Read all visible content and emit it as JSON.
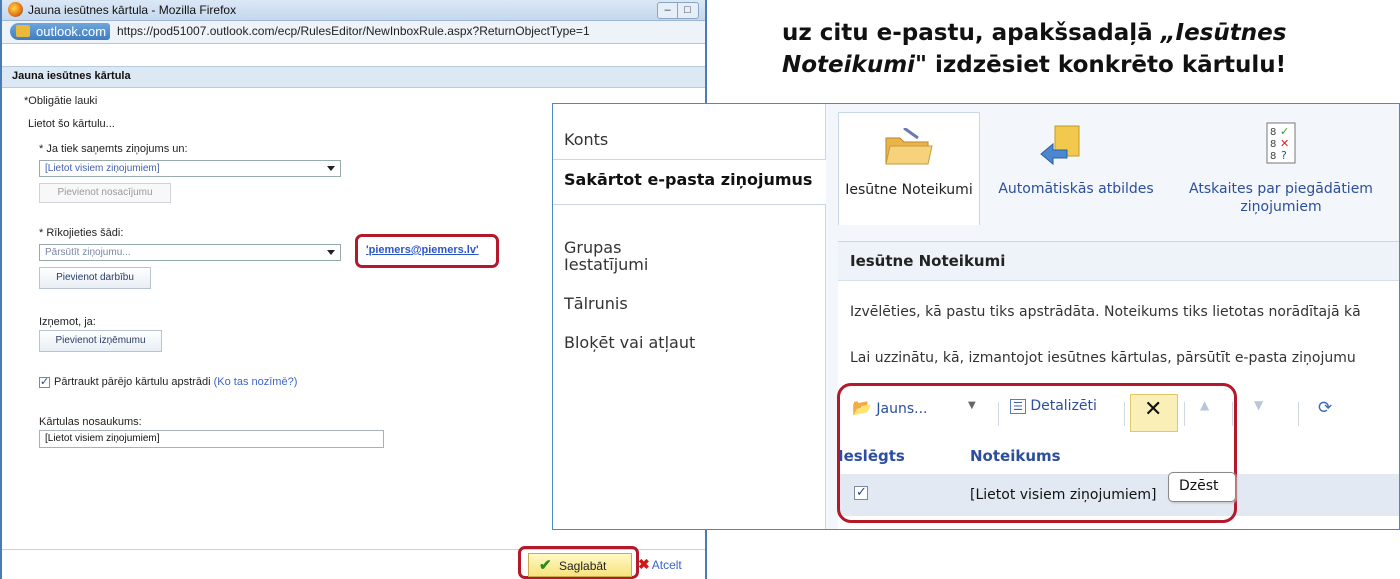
{
  "doc": {
    "line1": "uz citu e-pastu, apakšsadaļā ",
    "line1_italic": "„Iesūtnes",
    "line2_italic": "Noteikumi\"",
    "line2_rest": " izdzēsiet konkrēto kārtulu!"
  },
  "firefox": {
    "title": "Jauna iesūtnes kārtula - Mozilla Firefox",
    "site": "outlook.com",
    "url": "https://pod51007.outlook.com/ecp/RulesEditor/NewInboxRule.aspx?ReturnObjectType=1"
  },
  "rule_editor": {
    "header": "Jauna iesūtnes kārtula",
    "required_note": "*Obligātie lauki",
    "apply_label": "Lietot šo kārtulu...",
    "condition_label": "* Ja tiek saņemts ziņojums un:",
    "condition_value": "[Lietot visiem ziņojumiem]",
    "add_condition": "Pievienot nosacījumu",
    "action_label": "* Rīkojieties šādi:",
    "action_value": "Pārsūtīt ziņojumu...",
    "action_email": "'piemers@piemers.lv'",
    "add_action": "Pievienot darbību",
    "except_label": "Izņemot, ja:",
    "add_exception": "Pievienot izņēmumu",
    "stop_processing": "Pārtraukt pārējo kārtulu apstrādi",
    "what_link": "(Ko tas nozīmē?)",
    "name_label": "Kārtulas nosaukums:",
    "name_value": "[Lietot visiem ziņojumiem]",
    "save": "Saglabāt",
    "cancel": "Atcelt"
  },
  "options": {
    "nav": [
      "Konts",
      "Sakārtot e-pasta ziņojumus",
      "Grupas",
      "Iestatījumi",
      "Tālrunis",
      "Bloķēt vai atļaut"
    ],
    "tabs": {
      "inbox_rules": "Iesūtne Noteikumi",
      "auto_replies": "Automātiskās atbildes",
      "delivery_reports_1": "Atskaites par piegādātiem",
      "delivery_reports_2": "ziņojumiem"
    },
    "section_title": "Iesūtne Noteikumi",
    "desc1": "Izvēlēties, kā pastu tiks apstrādāta. Noteikums tiks lietotas norādītajā kā",
    "desc2": "Lai uzzinātu, kā, izmantojot iesūtnes kārtulas, pārsūtīt e-pasta ziņojumu",
    "toolbar": {
      "new": "Jauns...",
      "details": "Detalizēti"
    },
    "columns": {
      "enabled": "Ieslēgts",
      "rule": "Noteikums"
    },
    "row": {
      "rule": "[Lietot visiem ziņojumiem]"
    },
    "tooltip": "Dzēst"
  }
}
